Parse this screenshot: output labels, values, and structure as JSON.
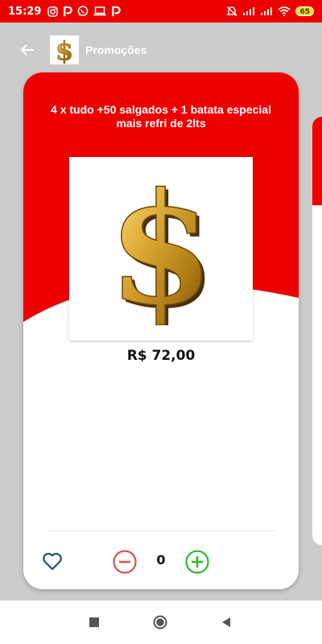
{
  "status_bar": {
    "time": "15:29",
    "battery": "65",
    "icons": [
      "instagram-icon",
      "p-app-icon",
      "whatsapp-icon",
      "laptop-icon",
      "p-app-icon",
      "mute-icon",
      "signal-icon",
      "signal-icon",
      "wifi-icon",
      "battery-icon"
    ]
  },
  "header": {
    "title": "Promoções",
    "back_icon": "arrow-left-icon",
    "logo_icon": "dollar-sign-logo"
  },
  "product": {
    "title": "4 x tudo +50 salgados + 1 batata especial mais refri de 2lts",
    "price": "R$ 72,00",
    "quantity": "0",
    "image": "dollar-sign-image"
  },
  "actions": {
    "favorite_icon": "heart-icon",
    "decrease_icon": "minus-circle-icon",
    "increase_icon": "plus-circle-icon"
  },
  "navigation": {
    "buttons": [
      "recent-apps-icon",
      "home-icon",
      "back-icon"
    ]
  },
  "colors": {
    "primary_red": "#ee0000",
    "minus_red": "#d9534f",
    "plus_green": "#2eb82e",
    "heart_blue": "#1f4e8c",
    "gold": "#d4a017"
  }
}
